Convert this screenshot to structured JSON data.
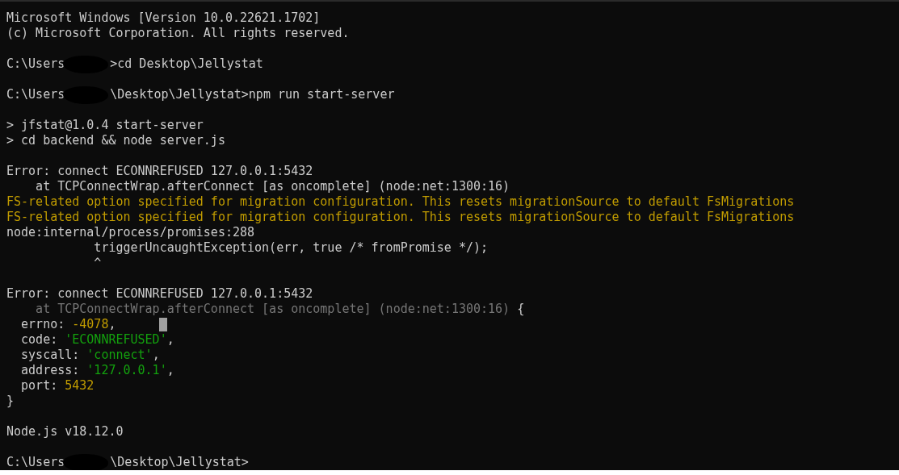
{
  "terminal": {
    "lines": [
      {
        "kind": "text",
        "segments": [
          {
            "kind": "plain",
            "text": "Microsoft Windows [Version 10.0.22621.1702]"
          }
        ]
      },
      {
        "kind": "text",
        "segments": [
          {
            "kind": "plain",
            "text": "(c) Microsoft Corporation. All rights reserved."
          }
        ]
      },
      {
        "kind": "blank"
      },
      {
        "kind": "text",
        "segments": [
          {
            "kind": "plain",
            "text": "C:\\Users"
          },
          {
            "kind": "redacted"
          },
          {
            "kind": "plain",
            "text": ">cd Desktop\\Jellystat"
          }
        ]
      },
      {
        "kind": "blank"
      },
      {
        "kind": "text",
        "segments": [
          {
            "kind": "plain",
            "text": "C:\\Users"
          },
          {
            "kind": "redacted"
          },
          {
            "kind": "plain",
            "text": "\\Desktop\\Jellystat>npm run start-server"
          }
        ]
      },
      {
        "kind": "blank"
      },
      {
        "kind": "text",
        "segments": [
          {
            "kind": "plain",
            "text": "> jfstat@1.0.4 start-server"
          }
        ]
      },
      {
        "kind": "text",
        "segments": [
          {
            "kind": "plain",
            "text": "> cd backend && node server.js"
          }
        ]
      },
      {
        "kind": "blank"
      },
      {
        "kind": "text",
        "segments": [
          {
            "kind": "plain",
            "text": "Error: connect ECONNREFUSED 127.0.0.1:5432"
          }
        ]
      },
      {
        "kind": "text",
        "segments": [
          {
            "kind": "plain",
            "text": "    at TCPConnectWrap.afterConnect [as oncomplete] (node:net:1300:16)"
          }
        ]
      },
      {
        "kind": "text",
        "segments": [
          {
            "kind": "warn",
            "text": "FS-related option specified for migration configuration. This resets migrationSource to default FsMigrations"
          }
        ]
      },
      {
        "kind": "text",
        "segments": [
          {
            "kind": "warn",
            "text": "FS-related option specified for migration configuration. This resets migrationSource to default FsMigrations"
          }
        ]
      },
      {
        "kind": "text",
        "segments": [
          {
            "kind": "plain",
            "text": "node:internal/process/promises:288"
          }
        ]
      },
      {
        "kind": "text",
        "segments": [
          {
            "kind": "plain",
            "text": "            triggerUncaughtException(err, true /* fromPromise */);"
          }
        ]
      },
      {
        "kind": "text",
        "segments": [
          {
            "kind": "plain",
            "text": "            ^"
          }
        ]
      },
      {
        "kind": "blank"
      },
      {
        "kind": "text",
        "segments": [
          {
            "kind": "plain",
            "text": "Error: connect ECONNREFUSED 127.0.0.1:5432"
          }
        ]
      },
      {
        "kind": "text",
        "segments": [
          {
            "kind": "dim",
            "text": "    at TCPConnectWrap.afterConnect [as oncomplete] (node:net:1300:16)"
          },
          {
            "kind": "plain",
            "text": " {"
          }
        ]
      },
      {
        "kind": "text",
        "cursor": true,
        "segments": [
          {
            "kind": "plain",
            "text": "  errno: "
          },
          {
            "kind": "number",
            "text": "-4078"
          },
          {
            "kind": "plain",
            "text": ","
          }
        ]
      },
      {
        "kind": "text",
        "segments": [
          {
            "kind": "plain",
            "text": "  code: "
          },
          {
            "kind": "string",
            "text": "'ECONNREFUSED'"
          },
          {
            "kind": "plain",
            "text": ","
          }
        ]
      },
      {
        "kind": "text",
        "segments": [
          {
            "kind": "plain",
            "text": "  syscall: "
          },
          {
            "kind": "string",
            "text": "'connect'"
          },
          {
            "kind": "plain",
            "text": ","
          }
        ]
      },
      {
        "kind": "text",
        "segments": [
          {
            "kind": "plain",
            "text": "  address: "
          },
          {
            "kind": "string",
            "text": "'127.0.0.1'"
          },
          {
            "kind": "plain",
            "text": ","
          }
        ]
      },
      {
        "kind": "text",
        "segments": [
          {
            "kind": "plain",
            "text": "  port: "
          },
          {
            "kind": "number",
            "text": "5432"
          }
        ]
      },
      {
        "kind": "text",
        "segments": [
          {
            "kind": "plain",
            "text": "}"
          }
        ]
      },
      {
        "kind": "blank"
      },
      {
        "kind": "text",
        "segments": [
          {
            "kind": "plain",
            "text": "Node.js v18.12.0"
          }
        ]
      },
      {
        "kind": "blank"
      },
      {
        "kind": "text",
        "segments": [
          {
            "kind": "plain",
            "text": "C:\\Users"
          },
          {
            "kind": "redacted"
          },
          {
            "kind": "plain",
            "text": "\\Desktop\\Jellystat>"
          }
        ]
      }
    ]
  }
}
